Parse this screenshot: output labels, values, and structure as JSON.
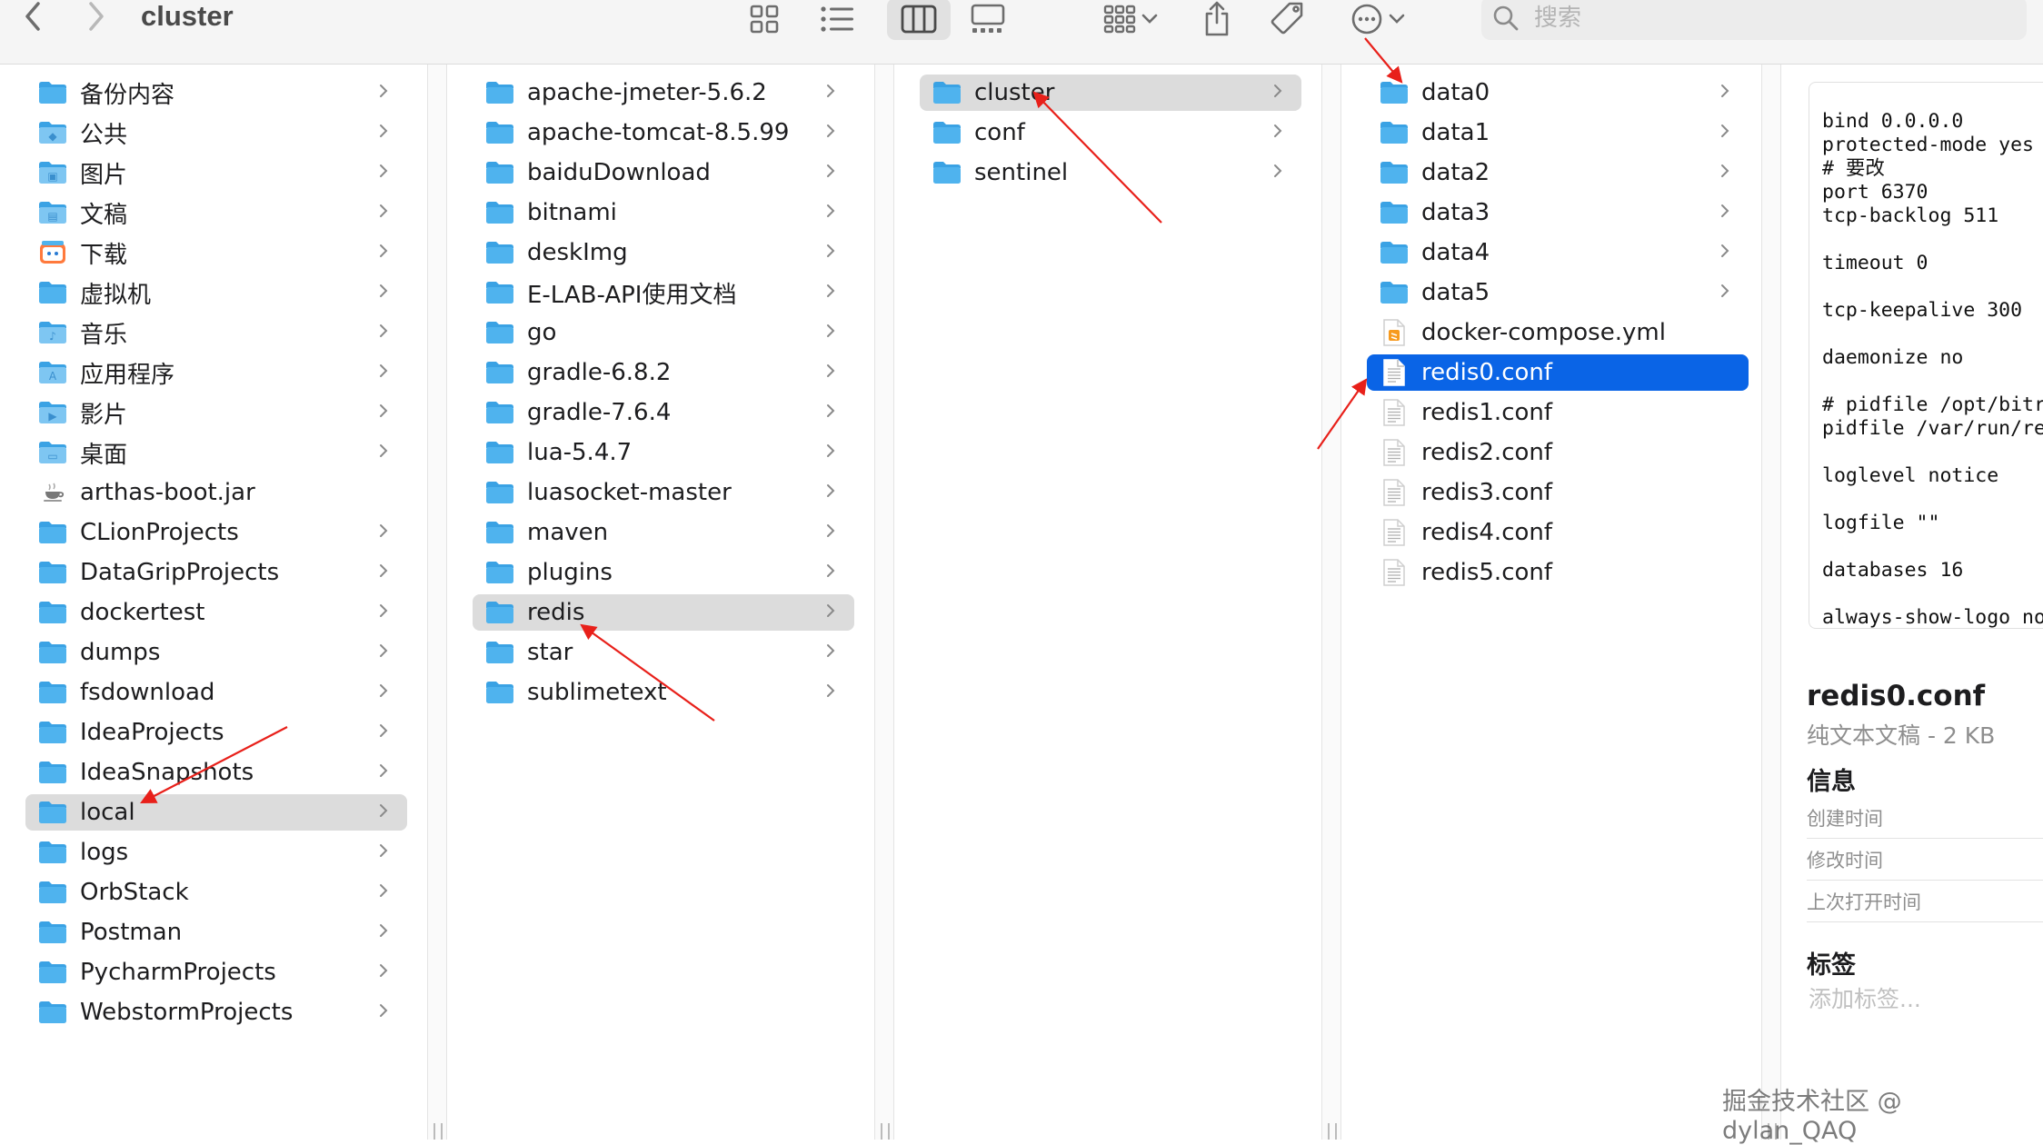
{
  "window": {
    "title": "cluster",
    "search_placeholder": "搜索"
  },
  "toolbar": {
    "active_view": "column",
    "icons": [
      "back-arrow-icon",
      "forward-arrow-icon",
      "icon-view-icon",
      "list-view-icon",
      "column-view-icon",
      "gallery-view-icon",
      "group-icon",
      "share-icon",
      "tag-icon",
      "more-icon"
    ]
  },
  "columns": [
    {
      "items": [
        {
          "label": "备份内容",
          "icon": "folder",
          "chevron": true
        },
        {
          "label": "公共",
          "icon": "public-folder",
          "chevron": true
        },
        {
          "label": "图片",
          "icon": "pictures-folder",
          "chevron": true
        },
        {
          "label": "文稿",
          "icon": "documents-folder",
          "chevron": true
        },
        {
          "label": "下载",
          "icon": "downloads-folder",
          "chevron": true
        },
        {
          "label": "虚拟机",
          "icon": "folder",
          "chevron": true
        },
        {
          "label": "音乐",
          "icon": "music-folder",
          "chevron": true
        },
        {
          "label": "应用程序",
          "icon": "applications-folder",
          "chevron": true
        },
        {
          "label": "影片",
          "icon": "movies-folder",
          "chevron": true
        },
        {
          "label": "桌面",
          "icon": "desktop-folder",
          "chevron": true
        },
        {
          "label": "arthas-boot.jar",
          "icon": "jar-file",
          "chevron": false
        },
        {
          "label": "CLionProjects",
          "icon": "folder",
          "chevron": true
        },
        {
          "label": "DataGripProjects",
          "icon": "folder",
          "chevron": true
        },
        {
          "label": "dockertest",
          "icon": "folder",
          "chevron": true
        },
        {
          "label": "dumps",
          "icon": "folder",
          "chevron": true
        },
        {
          "label": "fsdownload",
          "icon": "folder",
          "chevron": true
        },
        {
          "label": "IdeaProjects",
          "icon": "folder",
          "chevron": true
        },
        {
          "label": "IdeaSnapshots",
          "icon": "folder",
          "chevron": true
        },
        {
          "label": "local",
          "icon": "folder",
          "chevron": true,
          "selected": "gray"
        },
        {
          "label": "logs",
          "icon": "folder",
          "chevron": true
        },
        {
          "label": "OrbStack",
          "icon": "folder",
          "chevron": true
        },
        {
          "label": "Postman",
          "icon": "folder",
          "chevron": true
        },
        {
          "label": "PycharmProjects",
          "icon": "folder",
          "chevron": true
        },
        {
          "label": "WebstormProjects",
          "icon": "folder",
          "chevron": true
        }
      ]
    },
    {
      "items": [
        {
          "label": "apache-jmeter-5.6.2",
          "icon": "folder",
          "chevron": true
        },
        {
          "label": "apache-tomcat-8.5.99",
          "icon": "folder",
          "chevron": true
        },
        {
          "label": "baiduDownload",
          "icon": "folder",
          "chevron": true
        },
        {
          "label": "bitnami",
          "icon": "folder",
          "chevron": true
        },
        {
          "label": "deskImg",
          "icon": "folder",
          "chevron": true
        },
        {
          "label": "E-LAB-API使用文档",
          "icon": "folder",
          "chevron": true
        },
        {
          "label": "go",
          "icon": "folder",
          "chevron": true
        },
        {
          "label": "gradle-6.8.2",
          "icon": "folder",
          "chevron": true
        },
        {
          "label": "gradle-7.6.4",
          "icon": "folder",
          "chevron": true
        },
        {
          "label": "lua-5.4.7",
          "icon": "folder",
          "chevron": true
        },
        {
          "label": "luasocket-master",
          "icon": "folder",
          "chevron": true
        },
        {
          "label": "maven",
          "icon": "folder",
          "chevron": true
        },
        {
          "label": "plugins",
          "icon": "folder",
          "chevron": true
        },
        {
          "label": "redis",
          "icon": "folder",
          "chevron": true,
          "selected": "gray"
        },
        {
          "label": "star",
          "icon": "folder",
          "chevron": true
        },
        {
          "label": "sublimetext",
          "icon": "folder",
          "chevron": true
        }
      ]
    },
    {
      "items": [
        {
          "label": "cluster",
          "icon": "folder",
          "chevron": true,
          "selected": "gray"
        },
        {
          "label": "conf",
          "icon": "folder",
          "chevron": true
        },
        {
          "label": "sentinel",
          "icon": "folder",
          "chevron": true
        }
      ]
    },
    {
      "items": [
        {
          "label": "data0",
          "icon": "folder",
          "chevron": true
        },
        {
          "label": "data1",
          "icon": "folder",
          "chevron": true
        },
        {
          "label": "data2",
          "icon": "folder",
          "chevron": true
        },
        {
          "label": "data3",
          "icon": "folder",
          "chevron": true
        },
        {
          "label": "data4",
          "icon": "folder",
          "chevron": true
        },
        {
          "label": "data5",
          "icon": "folder",
          "chevron": true
        },
        {
          "label": "docker-compose.yml",
          "icon": "yml-file",
          "chevron": false
        },
        {
          "label": "redis0.conf",
          "icon": "text-file",
          "chevron": false,
          "selected": "blue"
        },
        {
          "label": "redis1.conf",
          "icon": "text-file",
          "chevron": false
        },
        {
          "label": "redis2.conf",
          "icon": "text-file",
          "chevron": false
        },
        {
          "label": "redis3.conf",
          "icon": "text-file",
          "chevron": false
        },
        {
          "label": "redis4.conf",
          "icon": "text-file",
          "chevron": false
        },
        {
          "label": "redis5.conf",
          "icon": "text-file",
          "chevron": false
        }
      ]
    }
  ],
  "preview": {
    "content": "bind 0.0.0.0\nprotected-mode yes\n# 要改\nport 6370\ntcp-backlog 511\n\ntimeout 0\n\ntcp-keepalive 300\n\ndaemonize no\n\n# pidfile /opt/bitr\npidfile /var/run/re\n\nloglevel notice\n\nlogfile \"\"\n\ndatabases 16\n\nalways-show-logo no",
    "file_name": "redis0.conf",
    "file_kind": "纯文本文稿 - 2 KB",
    "info_heading": "信息",
    "info_rows": [
      "创建时间",
      "修改时间",
      "上次打开时间"
    ],
    "tags_heading": "标签",
    "tags_placeholder": "添加标签..."
  },
  "watermark": "掘金技术社区 @ dylan_QAQ",
  "colors": {
    "folder": "#4fb3ee",
    "folder_tab": "#3aa2e4",
    "selection_blue": "#0a64e6",
    "selection_gray": "#dcdcdc",
    "annotation_arrow": "#e8201a"
  }
}
